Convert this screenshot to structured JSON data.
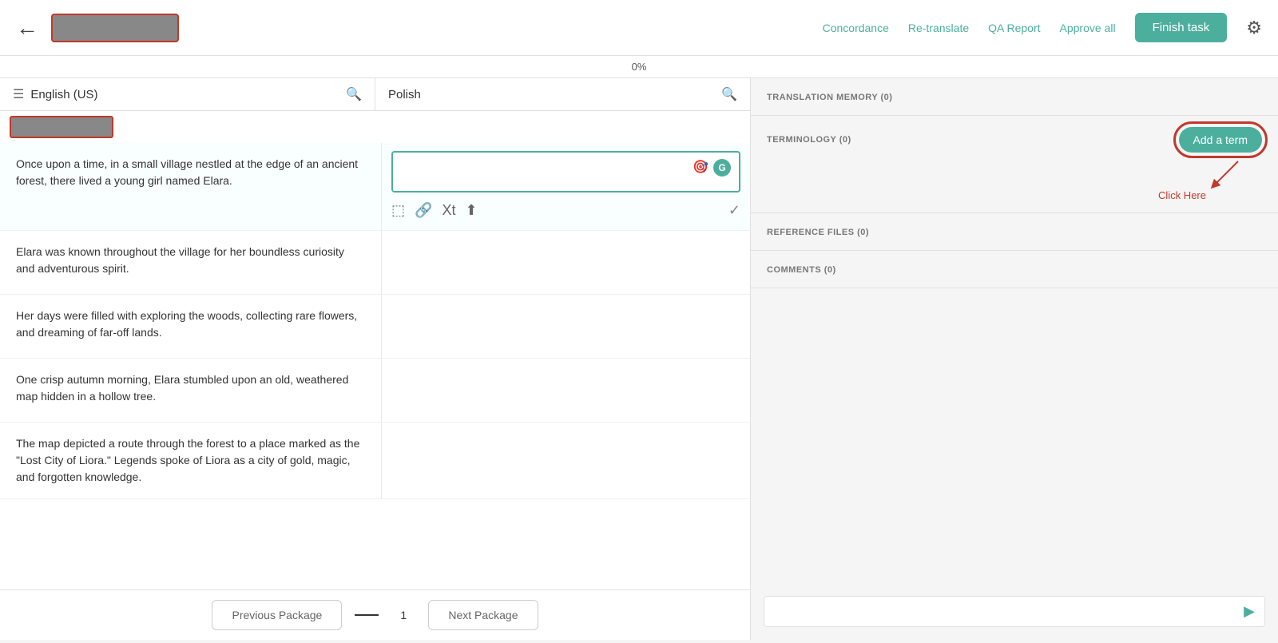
{
  "topbar": {
    "back_label": "←",
    "project_name": "",
    "nav_links": [
      "Concordance",
      "Re-translate",
      "QA Report",
      "Approve all"
    ],
    "finish_label": "Finish task"
  },
  "progress": {
    "value": "0%"
  },
  "columns": {
    "source_lang": "English (US)",
    "target_lang": "Polish"
  },
  "segments": [
    {
      "source": "Once upon a time, in a small village nestled at the edge of an ancient forest, there lived a young girl named Elara.",
      "target": "",
      "active": true
    },
    {
      "source": "Elara was known throughout the village for her boundless curiosity and adventurous spirit.",
      "target": ""
    },
    {
      "source": "Her days were filled with exploring the woods, collecting rare flowers, and dreaming of far-off lands.",
      "target": ""
    },
    {
      "source": "One crisp autumn morning, Elara stumbled upon an old, weathered map hidden in a hollow tree.",
      "target": ""
    },
    {
      "source": "The map depicted a route through the forest to a place marked as the \"Lost City of Liora.\" Legends spoke of Liora as a city of gold, magic, and forgotten knowledge.",
      "target": ""
    }
  ],
  "pagination": {
    "prev_label": "Previous Package",
    "next_label": "Next Package",
    "current_page": "1"
  },
  "right_panel": {
    "translation_memory_label": "TRANSLATION MEMORY (0)",
    "terminology_label": "TERMINOLOGY (0)",
    "add_term_label": "Add a term",
    "reference_files_label": "REFERENCE FILES (0)",
    "comments_label": "COMMENTS (0)",
    "click_here_text": "Click Here",
    "comment_placeholder": ""
  },
  "toolbar": {
    "icons": [
      "insert-source",
      "link",
      "translate",
      "upload"
    ],
    "check": "✓"
  }
}
